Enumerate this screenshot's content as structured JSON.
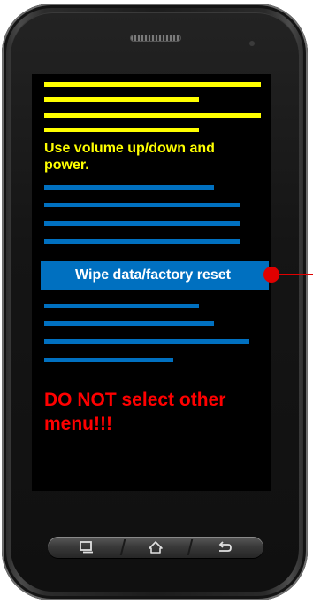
{
  "screen": {
    "instruction": "Use volume up/down and power.",
    "selected_option": "Wipe data/factory reset",
    "warning": "DO NOT select other menu!!!"
  },
  "navbar": {
    "buttons": [
      {
        "icon": "recent-apps-icon"
      },
      {
        "icon": "home-icon"
      },
      {
        "icon": "back-icon"
      }
    ]
  },
  "colors": {
    "header_bars": "#ffff00",
    "menu_bars": "#0070c0",
    "instruction_text": "#ffff00",
    "highlight_background": "#0070c0",
    "warning_text": "#ff0000",
    "pointer": "#e00000"
  }
}
